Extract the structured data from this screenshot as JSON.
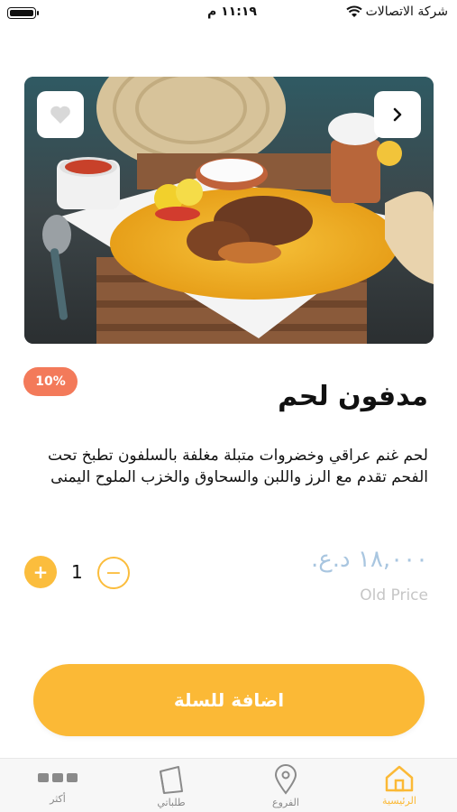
{
  "status_bar": {
    "carrier": "شركة الاتصالات",
    "time": "١١:١٩ م"
  },
  "product": {
    "discount": "10%",
    "title": "مدفون لحم",
    "description": "لحم غنم عراقي وخضروات متبلة مغلفة بالسلفون تطبخ تحت الفحم تقدم مع الرز واللبن والسحاوق والخزب الملوح اليمنى",
    "price": "١٨,٠٠٠ د.ع.",
    "old_price_label": "Old Price"
  },
  "quantity": {
    "value": "1",
    "plus_label": "+",
    "minus_label": "−"
  },
  "cart": {
    "add_label": "اضافة للسلة"
  },
  "nav": {
    "home": "الرئيسية",
    "branches": "الفروع",
    "orders": "طلباتي",
    "more": "أكثر"
  },
  "colors": {
    "accent": "#fbb936",
    "discount": "#f37a5a",
    "price": "#a9c6e0"
  }
}
